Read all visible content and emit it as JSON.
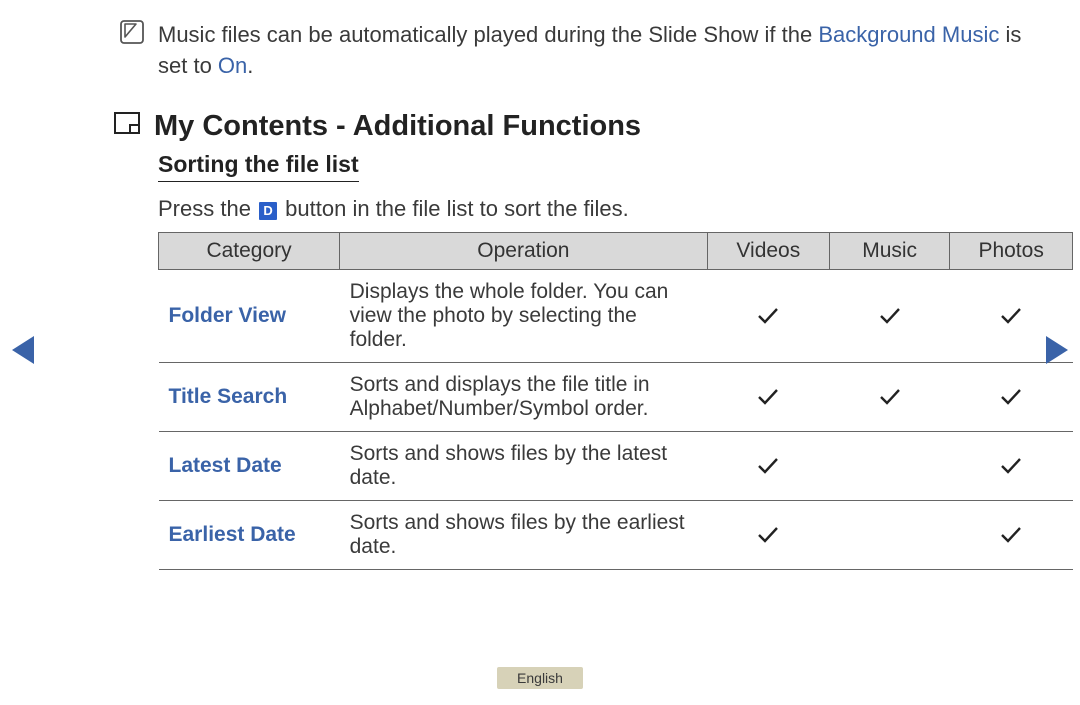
{
  "note": {
    "text_prefix": "Music files can be automatically played during the Slide Show if the ",
    "link1": "Background Music",
    "text_mid": " is set to ",
    "link2": "On",
    "text_suffix": "."
  },
  "section": {
    "title": "My Contents - Additional Functions",
    "sub_title": "Sorting the file list",
    "instruction_prefix": "Press the ",
    "button_label": "D",
    "instruction_suffix": " button in the file list to sort the files."
  },
  "table": {
    "headers": {
      "category": "Category",
      "operation": "Operation",
      "videos": "Videos",
      "music": "Music",
      "photos": "Photos"
    },
    "rows": [
      {
        "category": "Folder View",
        "operation": "Displays the whole folder. You can view the photo by selecting the folder.",
        "videos": true,
        "music": true,
        "photos": true
      },
      {
        "category": "Title Search",
        "operation": "Sorts and displays the file title in Alphabet/Number/Symbol order.",
        "videos": true,
        "music": true,
        "photos": true
      },
      {
        "category": "Latest Date",
        "operation": "Sorts and shows files by the latest date.",
        "videos": true,
        "music": false,
        "photos": true
      },
      {
        "category": "Earliest Date",
        "operation": "Sorts and shows files by the earliest date.",
        "videos": true,
        "music": false,
        "photos": true
      }
    ]
  },
  "footer": {
    "language": "English"
  }
}
